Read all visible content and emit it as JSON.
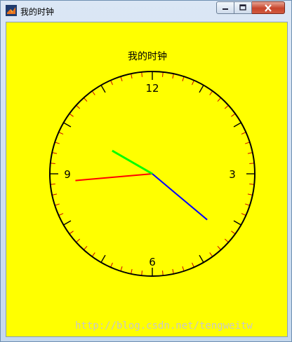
{
  "window": {
    "title": "我的时钟",
    "controls": {
      "minimize": "minimize",
      "maximize": "maximize",
      "close": "close"
    }
  },
  "figure": {
    "title": "我的时钟",
    "background_color": "#ffff00",
    "watermark": "http://blog.csdn.net/tengweitw"
  },
  "clock": {
    "numerals": {
      "twelve": "12",
      "three": "3",
      "six": "6",
      "nine": "9"
    },
    "face_color": "#000000",
    "tick_color": "#cc0000",
    "hands": {
      "hour": {
        "color": "#00ff00",
        "angle_deg": 300
      },
      "minute": {
        "color": "#0000ff",
        "angle_deg": 130
      },
      "second": {
        "color": "#ff0000",
        "angle_deg": 265
      }
    }
  }
}
